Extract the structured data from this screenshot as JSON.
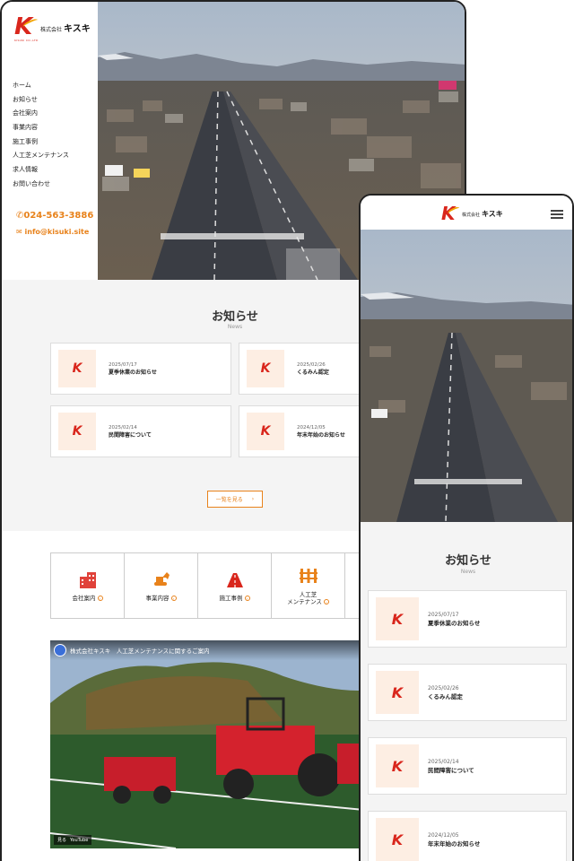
{
  "company": {
    "prefix": "株式会社",
    "name": "キスキ",
    "logo_sub": "KISUKI CO.,LTD"
  },
  "nav": [
    "ホーム",
    "お知らせ",
    "会社案内",
    "事業内容",
    "施工事例",
    "人工芝メンテナンス",
    "求人情報",
    "お問い合わせ"
  ],
  "contact": {
    "phone": "024-563-3886",
    "email": "info@kisuki.site"
  },
  "news": {
    "title": "お知らせ",
    "subtitle": "News",
    "more_label": "一覧を見る",
    "items": [
      {
        "date": "2025/07/17",
        "title": "夏季休業のお知らせ"
      },
      {
        "date": "2025/02/26",
        "title": "くるみん認定"
      },
      {
        "date": "2025/02/14",
        "title": "民間障害について"
      },
      {
        "date": "2024/12/05",
        "title": "年末年始のお知らせ"
      }
    ]
  },
  "services": [
    {
      "label": "会社案内",
      "icon": "building-icon"
    },
    {
      "label": "事業内容",
      "icon": "excavator-icon"
    },
    {
      "label": "施工事例",
      "icon": "road-icon"
    },
    {
      "label": "人工芝\nメンテナンス",
      "icon": "fence-icon"
    }
  ],
  "video": {
    "title": "株式会社キスキ　人工芝メンテナンスに関するご案内",
    "watch_label": "見る",
    "platform": "YouTube"
  },
  "colors": {
    "accent": "#e8821b",
    "brand_red": "#d9261c",
    "bg_gray": "#f4f4f4"
  }
}
